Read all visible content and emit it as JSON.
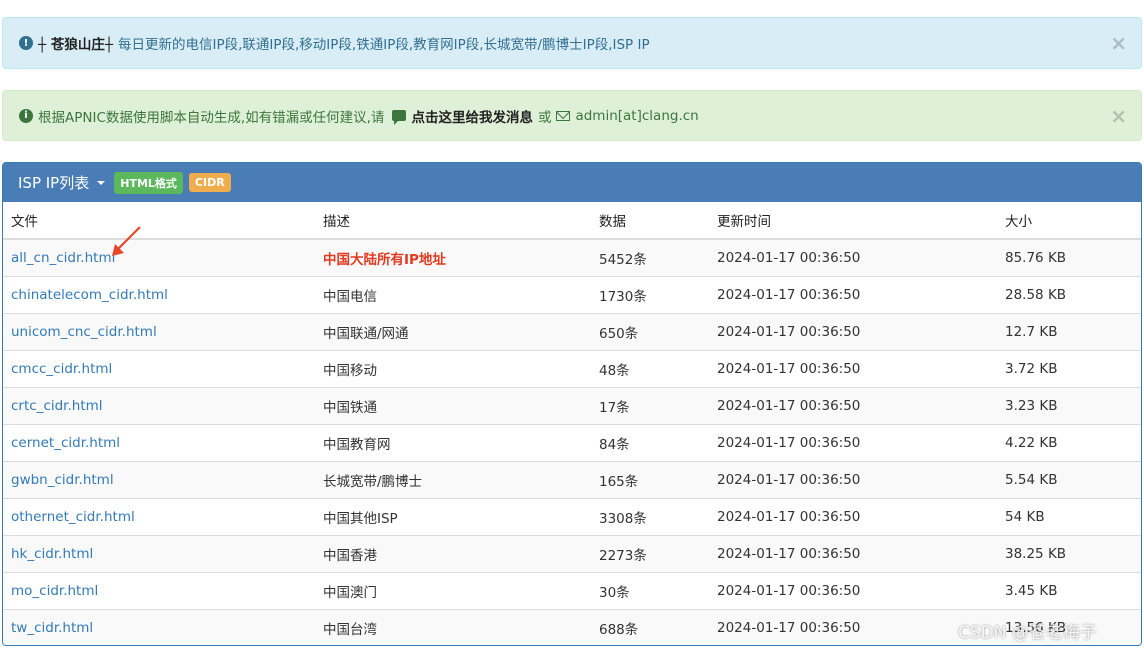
{
  "alerts": {
    "info": {
      "icon": "exclamation-circle-icon",
      "brand": "┼ 苍狼山庄┼",
      "text": "每日更新的电信IP段,联通IP段,移动IP段,铁通IP段,教育网IP段,长城宽带/鹏博士IP段,ISP IP",
      "close": "×"
    },
    "success": {
      "icon": "info-circle-icon",
      "text": "根据APNIC数据使用脚本自动生成,如有错漏或任何建议,请",
      "link": "点击这里给我发消息",
      "or": "或",
      "email": "admin[at]clang.cn",
      "close": "×"
    }
  },
  "panel": {
    "title": "ISP IP列表",
    "badges": {
      "html": "HTML格式",
      "cidr": "CIDR"
    }
  },
  "table": {
    "headers": {
      "file": "文件",
      "desc": "描述",
      "count": "数据",
      "updated": "更新时间",
      "size": "大小"
    },
    "rows": [
      {
        "file": "all_cn_cidr.html",
        "desc": "中国大陆所有IP地址",
        "count": "5452条",
        "updated": "2024-01-17 00:36:50",
        "size": "85.76 KB"
      },
      {
        "file": "chinatelecom_cidr.html",
        "desc": "中国电信",
        "count": "1730条",
        "updated": "2024-01-17 00:36:50",
        "size": "28.58 KB"
      },
      {
        "file": "unicom_cnc_cidr.html",
        "desc": "中国联通/网通",
        "count": "650条",
        "updated": "2024-01-17 00:36:50",
        "size": "12.7 KB"
      },
      {
        "file": "cmcc_cidr.html",
        "desc": "中国移动",
        "count": "48条",
        "updated": "2024-01-17 00:36:50",
        "size": "3.72 KB"
      },
      {
        "file": "crtc_cidr.html",
        "desc": "中国铁通",
        "count": "17条",
        "updated": "2024-01-17 00:36:50",
        "size": "3.23 KB"
      },
      {
        "file": "cernet_cidr.html",
        "desc": "中国教育网",
        "count": "84条",
        "updated": "2024-01-17 00:36:50",
        "size": "4.22 KB"
      },
      {
        "file": "gwbn_cidr.html",
        "desc": "长城宽带/鹏博士",
        "count": "165条",
        "updated": "2024-01-17 00:36:50",
        "size": "5.54 KB"
      },
      {
        "file": "othernet_cidr.html",
        "desc": "中国其他ISP",
        "count": "3308条",
        "updated": "2024-01-17 00:36:50",
        "size": "54 KB"
      },
      {
        "file": "hk_cidr.html",
        "desc": "中国香港",
        "count": "2273条",
        "updated": "2024-01-17 00:36:50",
        "size": "38.25 KB"
      },
      {
        "file": "mo_cidr.html",
        "desc": "中国澳门",
        "count": "30条",
        "updated": "2024-01-17 00:36:50",
        "size": "3.45 KB"
      },
      {
        "file": "tw_cidr.html",
        "desc": "中国台湾",
        "count": "688条",
        "updated": "2024-01-17 00:36:50",
        "size": "13.56 KB"
      }
    ]
  },
  "watermark": "CSDN @苍老梅子",
  "colors": {
    "highlight": "#e03a1f",
    "link": "#337ab7",
    "panel_header": "#4a7db5"
  }
}
